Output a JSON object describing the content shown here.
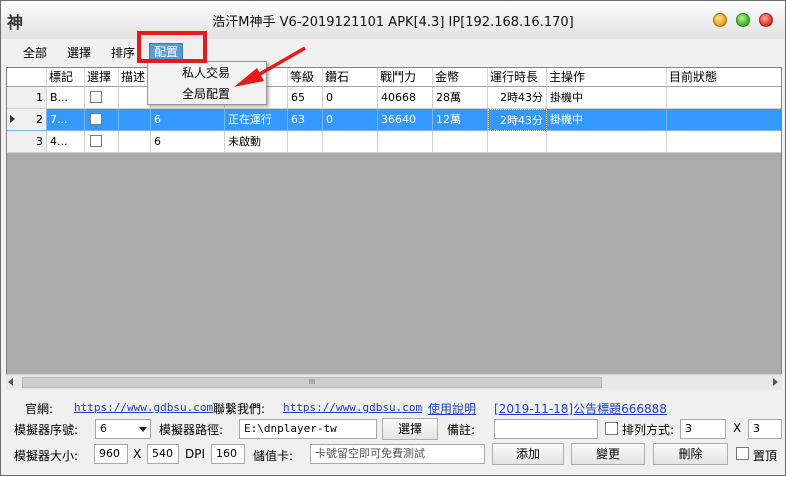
{
  "window": {
    "icon_glyph": "神",
    "title": "浩汗M神手 V6-2019121101 APK[4.3] IP[192.168.16.170]"
  },
  "menu": {
    "all": "全部",
    "select": "選擇",
    "sort": "排序",
    "config": "配置",
    "dropdown": [
      "私人交易",
      "全局配置"
    ]
  },
  "grid": {
    "columns": [
      "標記",
      "選擇",
      "描述",
      "",
      "",
      "等級",
      "鑽石",
      "戰鬥力",
      "金幣",
      "運行時長",
      "主操作",
      "目前狀態"
    ],
    "rows": [
      {
        "num": "1",
        "mark": "B...",
        "desc": "",
        "col4": "",
        "status_run": "行",
        "level": "65",
        "diamond": "0",
        "power": "40668",
        "gold": "28萬",
        "runtime": "2時43分",
        "op": "掛機中",
        "state": ""
      },
      {
        "num": "2",
        "mark": "7...",
        "desc": "",
        "col4": "6",
        "status_run": "正在運行",
        "level": "63",
        "diamond": "0",
        "power": "36640",
        "gold": "12萬",
        "runtime": "2時43分",
        "op": "掛機中",
        "state": ""
      },
      {
        "num": "3",
        "mark": "4...",
        "desc": "",
        "col4": "6",
        "status_run": "未啟動",
        "level": "",
        "diamond": "",
        "power": "",
        "gold": "",
        "runtime": "",
        "op": "",
        "state": ""
      }
    ],
    "selected_row": 2,
    "scroll_thumb_glyph": "III"
  },
  "bottom": {
    "official_label": "官網:",
    "official_url": "https://www.gdbsu.com",
    "contact_label": "聯繫我們:",
    "contact_url": "https://www.gdbsu.com",
    "manual_link": "使用說明",
    "notice_link": "[2019-11-18]公告標題666888",
    "emu_index_label": "模擬器序號:",
    "emu_index_value": "6",
    "emu_path_label": "模擬器路徑:",
    "emu_path_value": "E:\\dnplayer-tw",
    "select_button": "選擇",
    "remark_label": "備註:",
    "remark_value": "",
    "arrange_label": "排列方式:",
    "arrange_cols": "3",
    "arrange_x": "X",
    "arrange_rows": "3",
    "emu_size_label": "模擬器大小:",
    "emu_width": "960",
    "size_x": "X",
    "emu_height": "540",
    "dpi_label": "DPI",
    "dpi_value": "160",
    "card_label": "儲值卡:",
    "card_placeholder": "卡號留空即可免費測試",
    "add_button": "添加",
    "change_button": "變更",
    "delete_button": "刪除",
    "top_label": "置頂"
  },
  "colors": {
    "selection": "#3399ff",
    "highlight_red": "#e8191a",
    "link": "#1e3fbf",
    "menu_active": "#5b9bd5"
  }
}
